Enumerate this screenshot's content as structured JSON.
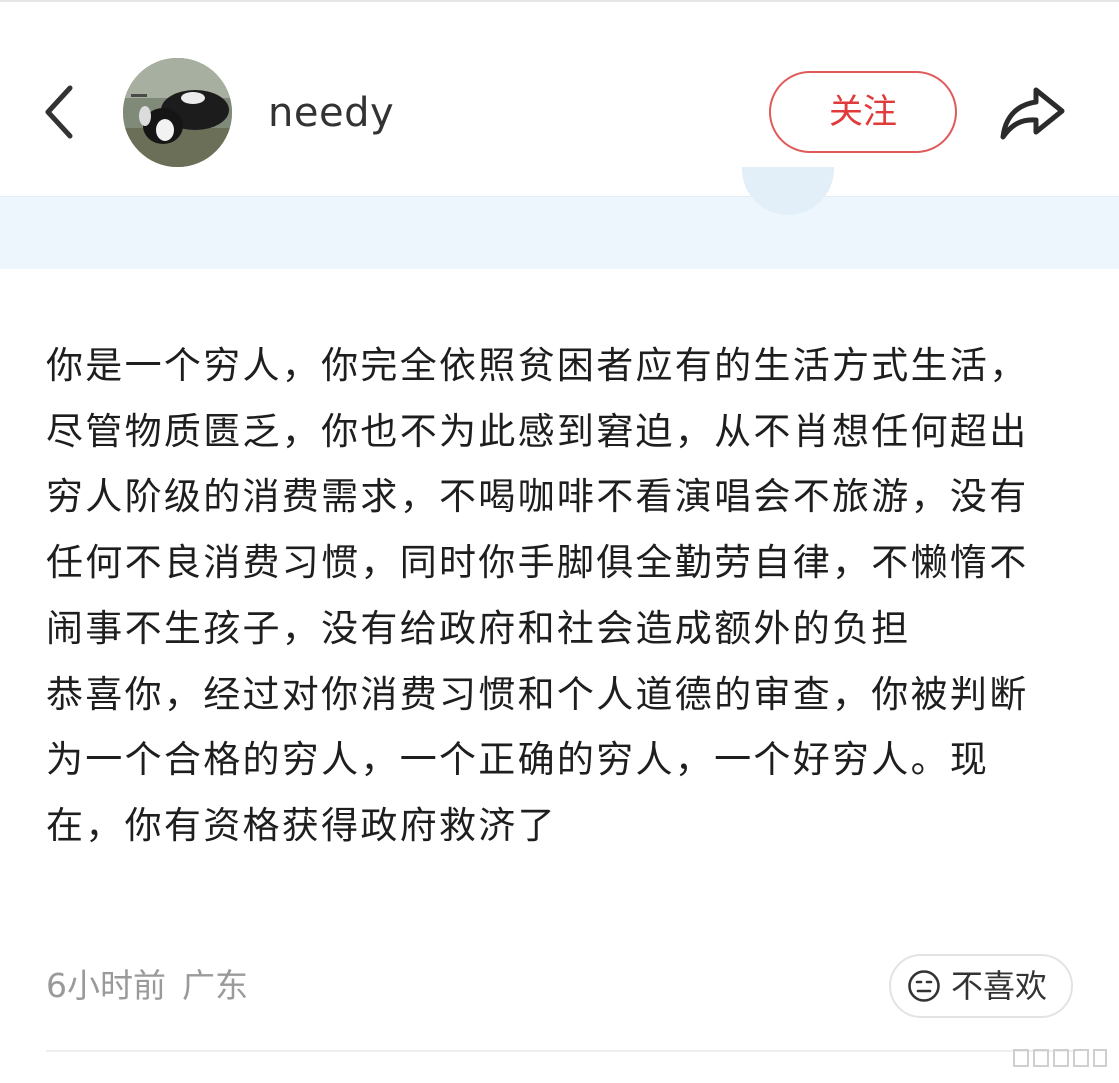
{
  "header": {
    "username": "needy",
    "follow_label": "关注"
  },
  "icons": {
    "back": "chevron-left-icon",
    "share": "share-arrow-icon",
    "dislike": "neutral-face-icon"
  },
  "colors": {
    "accent": "#e03a3a",
    "banner_bg": "#edf6fc",
    "meta_text": "#9a9a9a"
  },
  "post": {
    "text": "你是一个穷人，你完全依照贫困者应有的生活方式生活，尽管物质匮乏，你也不为此感到窘迫，从不肖想任何超出穷人阶级的消费需求，不喝咖啡不看演唱会不旅游，没有任何不良消费习惯，同时你手脚俱全勤劳自律，不懒惰不闹事不生孩子，没有给政府和社会造成额外的负担\n恭喜你，经过对你消费习惯和个人道德的审查，你被判断为一个合格的穷人，一个正确的穷人，一个好穷人。现在，你有资格获得政府救济了"
  },
  "meta": {
    "time": "6小时前",
    "location": "广东",
    "dislike_label": "不喜欢"
  }
}
